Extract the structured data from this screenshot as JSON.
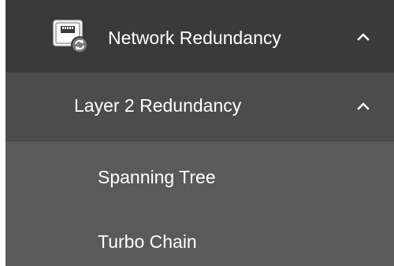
{
  "menu": {
    "network_redundancy": {
      "label": "Network Redundancy",
      "icon": "network-module-icon",
      "expanded_indicator": "chevron-up-icon"
    },
    "layer2_redundancy": {
      "label": "Layer 2 Redundancy",
      "expanded_indicator": "chevron-up-icon"
    },
    "items": [
      {
        "label": "Spanning Tree"
      },
      {
        "label": "Turbo Chain"
      }
    ]
  },
  "colors": {
    "level1_bg": "#3a3a3a",
    "level2_bg": "#4c4c4c",
    "level3_bg": "#5a5a5a",
    "text": "#ffffff"
  }
}
